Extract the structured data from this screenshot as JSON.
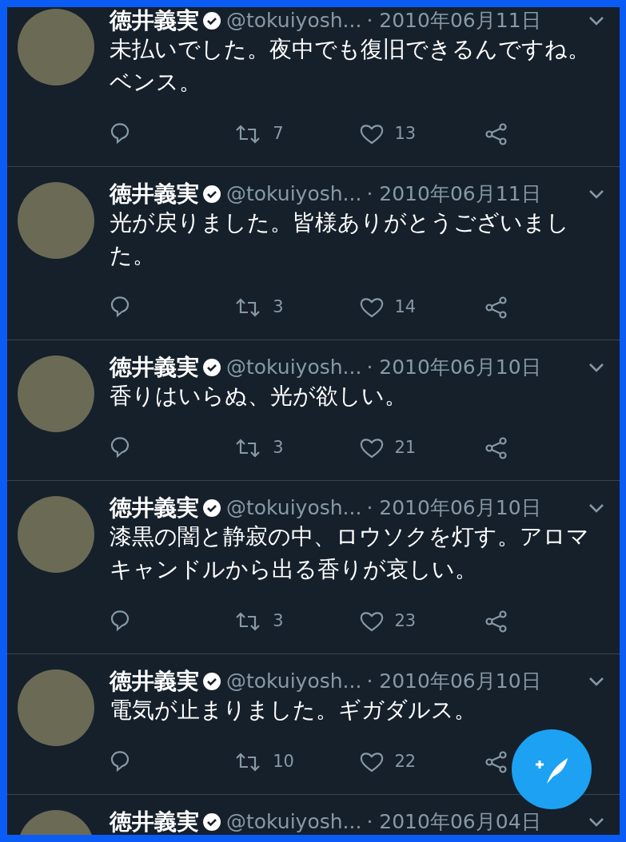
{
  "tweets": [
    {
      "name": "徳井義実",
      "verified": true,
      "handle": "@tokuiyosh...",
      "date": "· 2010年06月11日",
      "text": "未払いでした。夜中でも復旧できるんですね。ベンス。",
      "retweets": "7",
      "likes": "13"
    },
    {
      "name": "徳井義実",
      "verified": true,
      "handle": "@tokuiyosh...",
      "date": "· 2010年06月11日",
      "text": "光が戻りました。皆様ありがとうございました。",
      "retweets": "3",
      "likes": "14"
    },
    {
      "name": "徳井義実",
      "verified": true,
      "handle": "@tokuiyosh...",
      "date": "· 2010年06月10日",
      "text": "香りはいらぬ、光が欲しい。",
      "retweets": "3",
      "likes": "21"
    },
    {
      "name": "徳井義実",
      "verified": true,
      "handle": "@tokuiyosh...",
      "date": "· 2010年06月10日",
      "text": "漆黒の闇と静寂の中、ロウソクを灯す。アロマキャンドルから出る香りが哀しい。",
      "retweets": "3",
      "likes": "23"
    },
    {
      "name": "徳井義実",
      "verified": true,
      "handle": "@tokuiyosh...",
      "date": "· 2010年06月10日",
      "text": "電気が止まりました。ギガダルス。",
      "retweets": "10",
      "likes": "22"
    },
    {
      "name": "徳井義実",
      "verified": true,
      "handle": "@tokuiyosh...",
      "date": "· 2010年06月04日"
    }
  ]
}
